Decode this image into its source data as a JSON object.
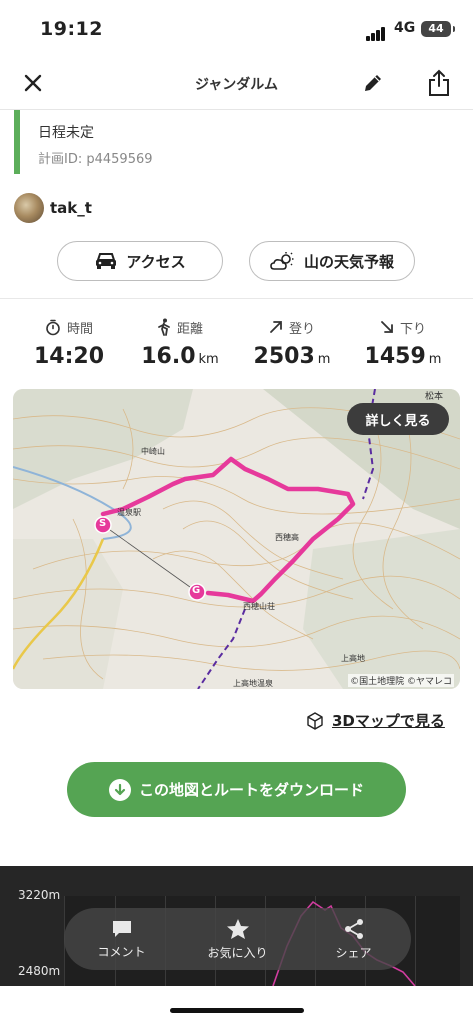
{
  "status_bar": {
    "time": "19:12",
    "network": "4G",
    "battery": "44"
  },
  "header": {
    "title": "ジャンダルム"
  },
  "plan": {
    "schedule": "日程未定",
    "plan_id": "計画ID: p4459569"
  },
  "user": {
    "name": "tak_t"
  },
  "buttons": {
    "access": "アクセス",
    "weather": "山の天気予報"
  },
  "stats": {
    "time": {
      "label": "時間",
      "value": "14:20",
      "unit": ""
    },
    "distance": {
      "label": "距離",
      "value": "16.0",
      "unit": "km"
    },
    "ascent": {
      "label": "登り",
      "value": "2503",
      "unit": "m"
    },
    "descent": {
      "label": "下り",
      "value": "1459",
      "unit": "m"
    }
  },
  "map": {
    "detail_button": "詳しく見る",
    "start_marker": "S",
    "goal_marker": "G",
    "credit": "©国土地理院 ©ヤマレコ",
    "route_color": "#e6399b",
    "place_labels": [
      "中崎山",
      "温泉駅",
      "西穂山荘",
      "上高地温泉",
      "上高地",
      "西穂高",
      "松本"
    ]
  },
  "links": {
    "map_3d": "3Dマップで見る"
  },
  "download": {
    "label": "この地図とルートをダウンロード"
  },
  "elevation": {
    "max_label": "3220m",
    "min_label": "2480m"
  },
  "actions": {
    "comment": "コメント",
    "favorite": "お気に入り",
    "share": "シェア"
  },
  "colors": {
    "accent_green": "#55a453",
    "plan_bar": "#5cae5a",
    "route": "#e6399b"
  }
}
